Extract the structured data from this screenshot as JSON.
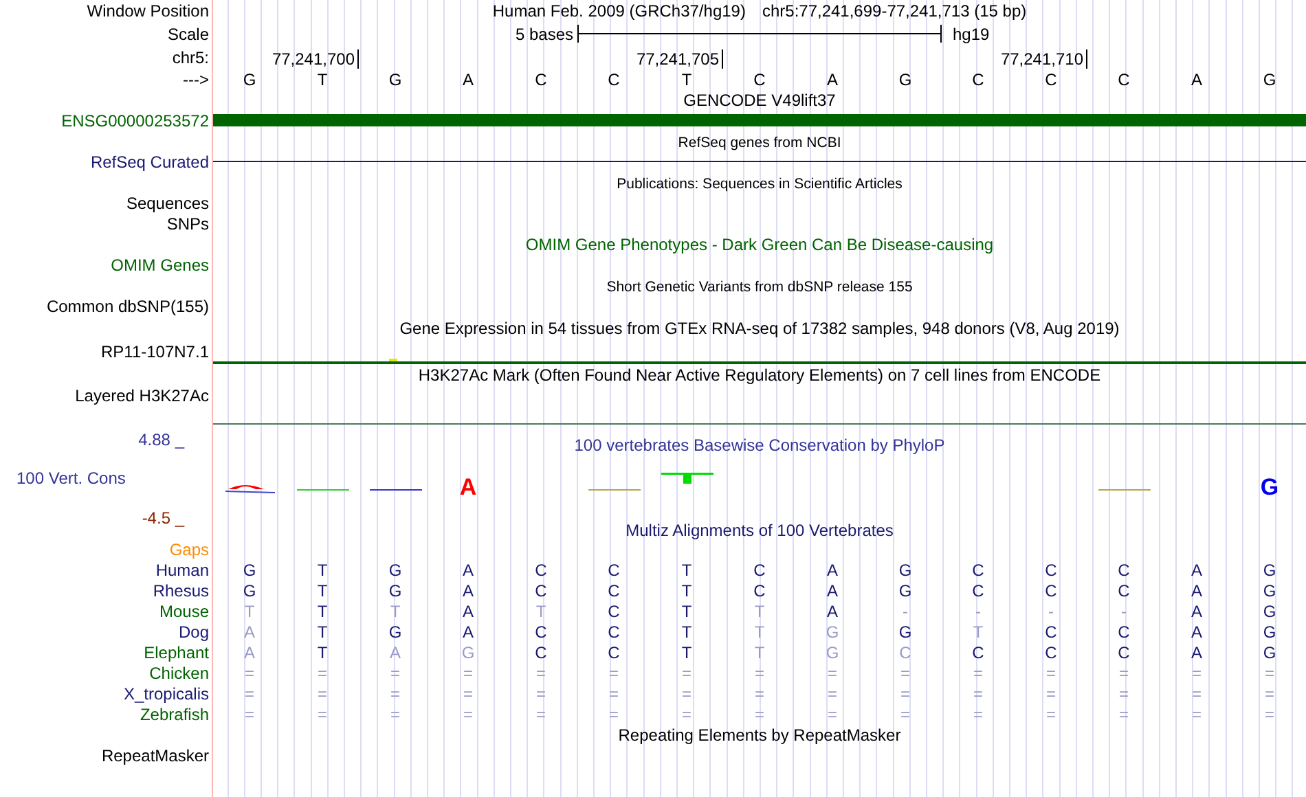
{
  "header": {
    "window_position_label": "Window Position",
    "assembly": "Human Feb. 2009 (GRCh37/hg19)",
    "position": "chr5:77,241,699-77,241,713 (15 bp)",
    "scale_label": "Scale",
    "scale_text": "5 bases",
    "scale_assembly": "hg19",
    "chrom_label": "chr5:",
    "strand_label": "--->"
  },
  "bases": [
    {
      "base": "G"
    },
    {
      "base": "T",
      "tick": "77,241,700"
    },
    {
      "base": "G"
    },
    {
      "base": "A"
    },
    {
      "base": "C"
    },
    {
      "base": "C"
    },
    {
      "base": "T",
      "tick": "77,241,705"
    },
    {
      "base": "C"
    },
    {
      "base": "A"
    },
    {
      "base": "G"
    },
    {
      "base": "C"
    },
    {
      "base": "C",
      "tick": "77,241,710"
    },
    {
      "base": "C"
    },
    {
      "base": "A"
    },
    {
      "base": "G"
    }
  ],
  "tracks": [
    {
      "kind": "gene",
      "title": {
        "text": "GENCODE V49lift37",
        "color": "#000000"
      },
      "compact": false,
      "labels": [
        {
          "text": "ENSG00000253572",
          "color": "#006400"
        }
      ]
    },
    {
      "kind": "line",
      "title": {
        "text": "RefSeq genes from NCBI",
        "color": "#000000"
      },
      "compact": true,
      "labels": [
        {
          "text": "RefSeq Curated",
          "color": "#191970"
        }
      ]
    },
    {
      "kind": "none",
      "title": {
        "text": "Publications: Sequences in Scientific Articles",
        "color": "#000000"
      },
      "compact": true,
      "labels": [
        {
          "text": "Sequences",
          "color": "#000000"
        },
        {
          "text": "SNPs",
          "color": "#000000"
        }
      ]
    },
    {
      "kind": "none",
      "title": {
        "text": "OMIM Gene Phenotypes - Dark Green Can Be Disease-causing",
        "color": "#006400"
      },
      "compact": false,
      "labels": [
        {
          "text": "OMIM Genes",
          "color": "#006400"
        }
      ]
    },
    {
      "kind": "none",
      "title": {
        "text": "Short Genetic Variants from dbSNP release 155",
        "color": "#000000"
      },
      "compact": true,
      "labels": [
        {
          "text": "Common dbSNP(155)",
          "color": "#000000"
        }
      ]
    },
    {
      "kind": "expression",
      "title": {
        "text": "Gene Expression in 54 tissues from GTEx RNA-seq of 17382 samples, 948 donors (V8, Aug 2019)",
        "color": "#000000"
      },
      "compact": false,
      "labels": [
        {
          "text": "RP11-107N7.1",
          "color": "#000000"
        }
      ]
    },
    {
      "kind": "baseline",
      "title": {
        "text": "H3K27Ac Mark (Often Found Near Active Regulatory Elements) on 7 cell lines from ENCODE",
        "color": "#000000"
      },
      "compact": false,
      "labels": [
        {
          "text": "Layered H3K27Ac",
          "color": "#000000"
        }
      ]
    }
  ],
  "conservation": {
    "title": "100 vertebrates Basewise Conservation by PhyloP",
    "label": "100 Vert. Cons",
    "axis_max": "4.88 _",
    "axis_min": "-4.5 _",
    "columns": [
      {
        "kind": "mark"
      },
      {
        "kind": "dash",
        "color": "#33cc33"
      },
      {
        "kind": "dash",
        "color": "#3333cc"
      },
      {
        "kind": "letter",
        "letter": "A",
        "color": "#ff0000"
      },
      {
        "kind": "none"
      },
      {
        "kind": "dash",
        "color": "#b3a64d"
      },
      {
        "kind": "bar",
        "color": "#00dd00"
      },
      {
        "kind": "none"
      },
      {
        "kind": "none"
      },
      {
        "kind": "none"
      },
      {
        "kind": "none"
      },
      {
        "kind": "none"
      },
      {
        "kind": "dash",
        "color": "#b3a64d"
      },
      {
        "kind": "none"
      },
      {
        "kind": "letter",
        "letter": "G",
        "color": "#0000ee"
      }
    ]
  },
  "alignment": {
    "title": "Multiz Alignments of 100 Vertebrates",
    "gaps": {
      "text": "Gaps",
      "color": "#ff8c00"
    },
    "species": [
      {
        "name": "Human",
        "color": "#191970",
        "bases": [
          {
            "b": "G",
            "faint": false
          },
          {
            "b": "T",
            "faint": false
          },
          {
            "b": "G",
            "faint": false
          },
          {
            "b": "A",
            "faint": false
          },
          {
            "b": "C",
            "faint": false
          },
          {
            "b": "C",
            "faint": false
          },
          {
            "b": "T",
            "faint": false
          },
          {
            "b": "C",
            "faint": false
          },
          {
            "b": "A",
            "faint": false
          },
          {
            "b": "G",
            "faint": false
          },
          {
            "b": "C",
            "faint": false
          },
          {
            "b": "C",
            "faint": false
          },
          {
            "b": "C",
            "faint": false
          },
          {
            "b": "A",
            "faint": false
          },
          {
            "b": "G",
            "faint": false
          }
        ]
      },
      {
        "name": "Rhesus",
        "color": "#191970",
        "bases": [
          {
            "b": "G",
            "faint": false
          },
          {
            "b": "T",
            "faint": false
          },
          {
            "b": "G",
            "faint": false
          },
          {
            "b": "A",
            "faint": false
          },
          {
            "b": "C",
            "faint": false
          },
          {
            "b": "C",
            "faint": false
          },
          {
            "b": "T",
            "faint": false
          },
          {
            "b": "C",
            "faint": false
          },
          {
            "b": "A",
            "faint": false
          },
          {
            "b": "G",
            "faint": false
          },
          {
            "b": "C",
            "faint": false
          },
          {
            "b": "C",
            "faint": false
          },
          {
            "b": "C",
            "faint": false
          },
          {
            "b": "A",
            "faint": false
          },
          {
            "b": "G",
            "faint": false
          }
        ]
      },
      {
        "name": "Mouse",
        "color": "#006400",
        "bases": [
          {
            "b": "T",
            "faint": true
          },
          {
            "b": "T",
            "faint": false
          },
          {
            "b": "T",
            "faint": true
          },
          {
            "b": "A",
            "faint": false
          },
          {
            "b": "T",
            "faint": true
          },
          {
            "b": "C",
            "faint": false
          },
          {
            "b": "T",
            "faint": false
          },
          {
            "b": "T",
            "faint": true
          },
          {
            "b": "A",
            "faint": false
          },
          {
            "b": "-",
            "faint": true
          },
          {
            "b": "-",
            "faint": true
          },
          {
            "b": "-",
            "faint": true
          },
          {
            "b": "-",
            "faint": true
          },
          {
            "b": "A",
            "faint": false
          },
          {
            "b": "G",
            "faint": false
          }
        ]
      },
      {
        "name": "Dog",
        "color": "#191970",
        "bases": [
          {
            "b": "A",
            "faint": true
          },
          {
            "b": "T",
            "faint": false
          },
          {
            "b": "G",
            "faint": false
          },
          {
            "b": "A",
            "faint": false
          },
          {
            "b": "C",
            "faint": false
          },
          {
            "b": "C",
            "faint": false
          },
          {
            "b": "T",
            "faint": false
          },
          {
            "b": "T",
            "faint": true
          },
          {
            "b": "G",
            "faint": true
          },
          {
            "b": "G",
            "faint": false
          },
          {
            "b": "T",
            "faint": true
          },
          {
            "b": "C",
            "faint": false
          },
          {
            "b": "C",
            "faint": false
          },
          {
            "b": "A",
            "faint": false
          },
          {
            "b": "G",
            "faint": false
          }
        ]
      },
      {
        "name": "Elephant",
        "color": "#006400",
        "bases": [
          {
            "b": "A",
            "faint": true
          },
          {
            "b": "T",
            "faint": false
          },
          {
            "b": "A",
            "faint": true
          },
          {
            "b": "G",
            "faint": true
          },
          {
            "b": "C",
            "faint": false
          },
          {
            "b": "C",
            "faint": false
          },
          {
            "b": "T",
            "faint": false
          },
          {
            "b": "T",
            "faint": true
          },
          {
            "b": "G",
            "faint": true
          },
          {
            "b": "C",
            "faint": true
          },
          {
            "b": "C",
            "faint": false
          },
          {
            "b": "C",
            "faint": false
          },
          {
            "b": "C",
            "faint": false
          },
          {
            "b": "A",
            "faint": false
          },
          {
            "b": "G",
            "faint": false
          }
        ]
      },
      {
        "name": "Chicken",
        "color": "#006400",
        "bases": [
          {
            "b": "=",
            "faint": true
          },
          {
            "b": "=",
            "faint": true
          },
          {
            "b": "=",
            "faint": true
          },
          {
            "b": "=",
            "faint": true
          },
          {
            "b": "=",
            "faint": true
          },
          {
            "b": "=",
            "faint": true
          },
          {
            "b": "=",
            "faint": true
          },
          {
            "b": "=",
            "faint": true
          },
          {
            "b": "=",
            "faint": true
          },
          {
            "b": "=",
            "faint": true
          },
          {
            "b": "=",
            "faint": true
          },
          {
            "b": "=",
            "faint": true
          },
          {
            "b": "=",
            "faint": true
          },
          {
            "b": "=",
            "faint": true
          },
          {
            "b": "=",
            "faint": true
          }
        ]
      },
      {
        "name": "X_tropicalis",
        "color": "#191970",
        "bases": [
          {
            "b": "=",
            "faint": true
          },
          {
            "b": "=",
            "faint": true
          },
          {
            "b": "=",
            "faint": true
          },
          {
            "b": "=",
            "faint": true
          },
          {
            "b": "=",
            "faint": true
          },
          {
            "b": "=",
            "faint": true
          },
          {
            "b": "=",
            "faint": true
          },
          {
            "b": "=",
            "faint": true
          },
          {
            "b": "=",
            "faint": true
          },
          {
            "b": "=",
            "faint": true
          },
          {
            "b": "=",
            "faint": true
          },
          {
            "b": "=",
            "faint": true
          },
          {
            "b": "=",
            "faint": true
          },
          {
            "b": "=",
            "faint": true
          },
          {
            "b": "=",
            "faint": true
          }
        ]
      },
      {
        "name": "Zebrafish",
        "color": "#006400",
        "bases": [
          {
            "b": "=",
            "faint": true
          },
          {
            "b": "=",
            "faint": true
          },
          {
            "b": "=",
            "faint": true
          },
          {
            "b": "=",
            "faint": true
          },
          {
            "b": "=",
            "faint": true
          },
          {
            "b": "=",
            "faint": true
          },
          {
            "b": "=",
            "faint": true
          },
          {
            "b": "=",
            "faint": true
          },
          {
            "b": "=",
            "faint": true
          },
          {
            "b": "=",
            "faint": true
          },
          {
            "b": "=",
            "faint": true
          },
          {
            "b": "=",
            "faint": true
          },
          {
            "b": "=",
            "faint": true
          },
          {
            "b": "=",
            "faint": true
          },
          {
            "b": "=",
            "faint": true
          }
        ]
      }
    ]
  },
  "repeats": {
    "title": "Repeating Elements by RepeatMasker",
    "label": "RepeatMasker"
  }
}
